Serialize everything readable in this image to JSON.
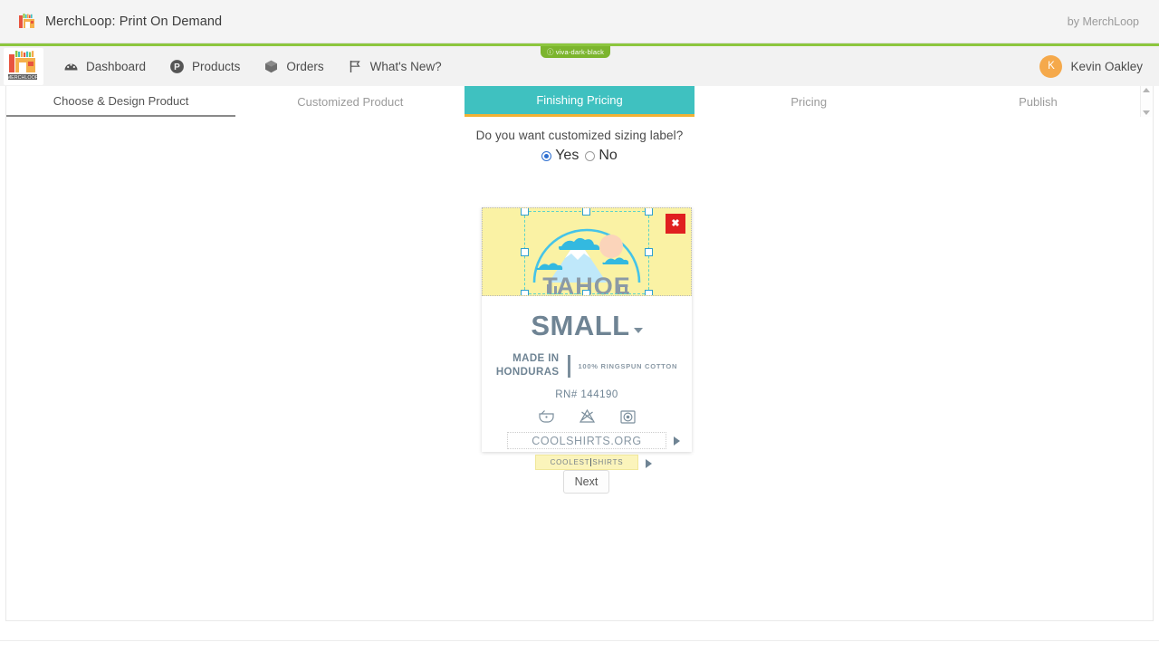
{
  "titlebar": {
    "app_title": "MerchLoop: Print On Demand",
    "by_text": "by MerchLoop",
    "logo_icon": "merchloop-shop-icon"
  },
  "appbar": {
    "brand_logo_text": "MERCHLOOP",
    "env_badge": "viva-dark-black",
    "accent_green": "#8cc63e",
    "nav": [
      {
        "label": "Dashboard",
        "icon": "speedometer-icon"
      },
      {
        "label": "Products",
        "icon": "product-p-circle-icon"
      },
      {
        "label": "Orders",
        "icon": "orders-package-icon"
      },
      {
        "label": "What's New?",
        "icon": "flag-icon"
      }
    ],
    "user": {
      "initial": "K",
      "name": "Kevin Oakley",
      "avatar_color": "#f5a94b"
    }
  },
  "tabs": [
    {
      "label": "Choose & Design Product",
      "state": "done"
    },
    {
      "label": "Customized Product",
      "state": "idle"
    },
    {
      "label": "Finishing Pricing",
      "state": "active"
    },
    {
      "label": "Pricing",
      "state": "idle"
    },
    {
      "label": "Publish",
      "state": "idle"
    }
  ],
  "tab_colors": {
    "active_bg": "#3fc1c0",
    "active_underline": "#f2b134"
  },
  "main": {
    "question": "Do you want customized sizing label?",
    "radios": [
      {
        "label": "Yes",
        "checked": true
      },
      {
        "label": "No",
        "checked": false
      }
    ],
    "next_label": "Next"
  },
  "label_card": {
    "art": {
      "design_name": "TAHOE",
      "background": "#faf2a4",
      "delete_label": "✖",
      "delete_color": "#e02020"
    },
    "size": "SMALL",
    "made_in_line1": "MADE IN",
    "made_in_line2": "HONDURAS",
    "material": "100% RINGSPUN COTTON",
    "rn": "RN# 144190",
    "care_icons": [
      {
        "name": "wash-tub-icon"
      },
      {
        "name": "do-not-bleach-icon"
      },
      {
        "name": "tumble-dry-icon"
      }
    ],
    "website_field": "COOLSHIRTS.ORG",
    "tagline_field_a": "COOLEST",
    "tagline_field_b": "SHIRTS"
  }
}
